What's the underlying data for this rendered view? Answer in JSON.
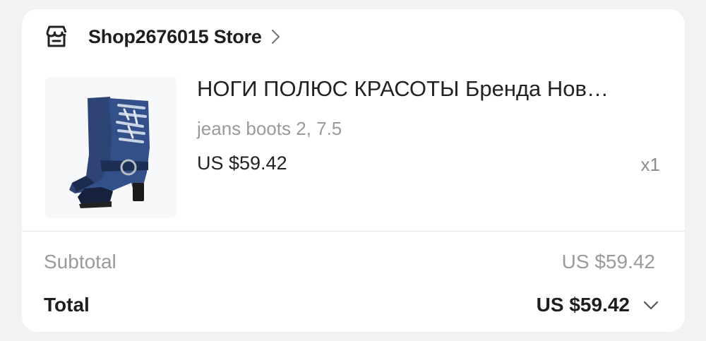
{
  "store": {
    "name": "Shop2676015 Store",
    "icon": "store-icon",
    "chevron_icon": "chevron-right-icon"
  },
  "product": {
    "image": "denim-boot-image",
    "title": "НОГИ ПОЛЮС КРАСОТЫ Бренда Нов…",
    "variant": "jeans boots 2, 7.5",
    "price": "US $59.42",
    "quantity": "x1"
  },
  "summary": {
    "subtotal_label": "Subtotal",
    "subtotal_value": "US $59.42",
    "total_label": "Total",
    "total_value": "US $59.42",
    "expand_icon": "chevron-down-icon"
  }
}
